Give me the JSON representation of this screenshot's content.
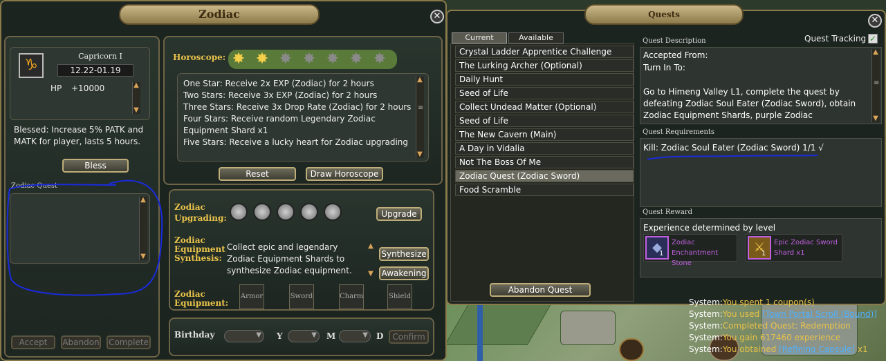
{
  "zodiac": {
    "title": "Zodiac",
    "sign_name": "Capricorn  I",
    "sign_dates": "12.22-01.19",
    "hp_label": "HP",
    "hp_value": "+10000",
    "blessing_text": "Blessed: Increase 5% PATK and MATK for player, lasts 5 hours.",
    "bless_button": "Bless",
    "zodiac_quest_label": "Zodiac Quest",
    "accept_button": "Accept",
    "abandon_button": "Abandon",
    "complete_button": "Complete",
    "horoscope_label": "Horoscope:",
    "horoscope_stars_filled": 2,
    "horoscope_stars_total": 7,
    "horoscope_lines": [
      "One Star: Receive 2x EXP (Zodiac) for 2 hours",
      "Two Stars: Receive 3x EXP (Zodiac) for 2 hours",
      "Three Stars: Receive 3x Drop Rate (Zodiac) for 2 hours",
      "Four Stars: Receive random Legendary Zodiac Equipment Shard x1",
      "Five Stars: Receive a lucky heart for Zodiac upgrading"
    ],
    "reset_button": "Reset",
    "draw_button": "Draw Horoscope",
    "upgrading_label_1": "Zodiac",
    "upgrading_label_2": "Upgrading:",
    "upgrade_button": "Upgrade",
    "synthesis_label_1": "Zodiac",
    "synthesis_label_2": "Equipment",
    "synthesis_label_3": "Synthesis:",
    "synthesis_text": "Collect epic and legendary Zodiac Equipment Shards to synthesize Zodiac equipment. Upon obtaining",
    "synthesize_button": "Synthesize",
    "awakening_button": "Awakening",
    "equipment_label_1": "Zodiac",
    "equipment_label_2": "Equipment:",
    "slots": [
      "Armor",
      "Sword",
      "Charm",
      "Shield"
    ],
    "birthday_label": "Birthday",
    "y_label": "Y",
    "m_label": "M",
    "d_label": "D",
    "confirm_button": "Confirm"
  },
  "quests": {
    "title": "Quests",
    "tab_current": "Current",
    "tab_available": "Available",
    "items": [
      "Crystal Ladder Apprentice Challenge",
      "The Lurking Archer (Optional)",
      "Daily Hunt",
      "Seed of Life",
      "Collect Undead Matter (Optional)",
      "Seed of Life",
      "The New Cavern (Main)",
      "A Day in Vidalia",
      "Not The Boss Of Me",
      "Zodiac Quest (Zodiac Sword)",
      "Food Scramble"
    ],
    "selected_index": 9,
    "abandon_quest_button": "Abandon Quest",
    "description_label": "Quest Description",
    "tracking_label": "Quest Tracking",
    "accepted_from": "Accepted From:",
    "turn_in_to": "Turn In To:",
    "description_text": "Go to Himeng Valley L1, complete the quest by defeating Zodiac Soul Eater (Zodiac Sword), obtain Zodiac Equipment Shards, purple Zodiac Enchantment Stones and massive",
    "requirements_label": "Quest Requirements",
    "requirement_text": "Kill: Zodiac Soul Eater (Zodiac Sword) 1/1  √",
    "reward_label": "Quest Reward",
    "reward_exp_text": "Experience determined by level",
    "reward1_line1": "Zodiac",
    "reward1_line2": "Enchantment Stone",
    "reward1_count": "1",
    "reward2_line1": "Epic Zodiac Sword",
    "reward2_line2": "Shard x1",
    "reward2_count": "1"
  },
  "chat": {
    "line1_prefix": "System:",
    "line1_text": "You spent 1 coupon(s)",
    "line2_prefix": "System:",
    "line2_text": "You used ",
    "line2_item": "[Town Portal Scroll (Bound)]",
    "line3_prefix": "System:",
    "line3_text": "Completed Quest: Redemption",
    "line4_prefix": "System:",
    "line4_text": "You gain 617460 experience",
    "line5_prefix": "System:",
    "line5_text": "You obtained ",
    "line5_item": "[Refining Capsule]",
    "line5_suffix": " x1"
  },
  "colors": {
    "system_prefix": "#ffffff",
    "system_text": "#e8c24a",
    "item_link": "#4fb2ff",
    "reward_text": "#c060e0",
    "gold_label": "#e8c24a"
  }
}
